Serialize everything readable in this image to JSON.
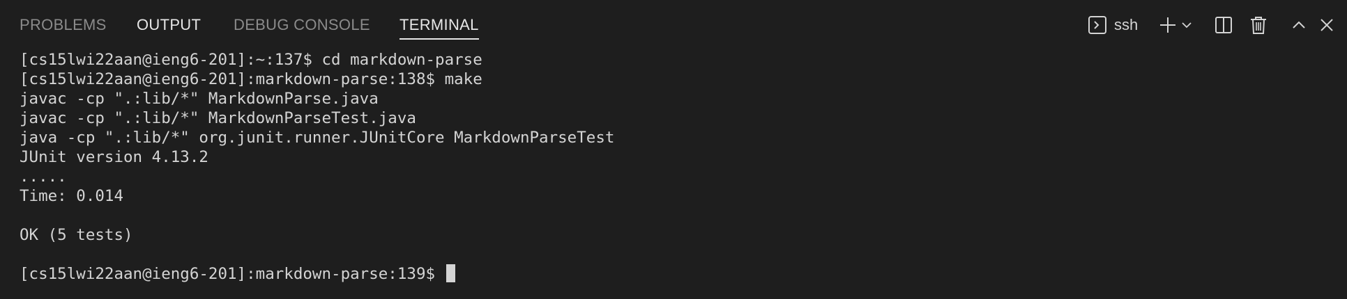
{
  "tabs": [
    {
      "label": "PROBLEMS"
    },
    {
      "label": "OUTPUT"
    },
    {
      "label": "DEBUG CONSOLE"
    },
    {
      "label": "TERMINAL"
    }
  ],
  "actions": {
    "terminal_name": "ssh",
    "icons": [
      "terminal-icon",
      "plus-icon",
      "chevron-down-icon",
      "split-icon",
      "trash-icon",
      "chevron-up-icon",
      "close-icon"
    ]
  },
  "terminal": {
    "lines": [
      "[cs15lwi22aan@ieng6-201]:~:137$ cd markdown-parse",
      "[cs15lwi22aan@ieng6-201]:markdown-parse:138$ make",
      "javac -cp \".:lib/*\" MarkdownParse.java",
      "javac -cp \".:lib/*\" MarkdownParseTest.java",
      "java -cp \".:lib/*\" org.junit.runner.JUnitCore MarkdownParseTest",
      "JUnit version 4.13.2",
      ".....",
      "Time: 0.014",
      "",
      "OK (5 tests)",
      "",
      "[cs15lwi22aan@ieng6-201]:markdown-parse:139$ "
    ]
  },
  "colors": {
    "background": "#1e1e1e",
    "text": "#d4d4d4",
    "inactive_tab": "#8b8b8b",
    "active_tab": "#e7e7e7"
  }
}
